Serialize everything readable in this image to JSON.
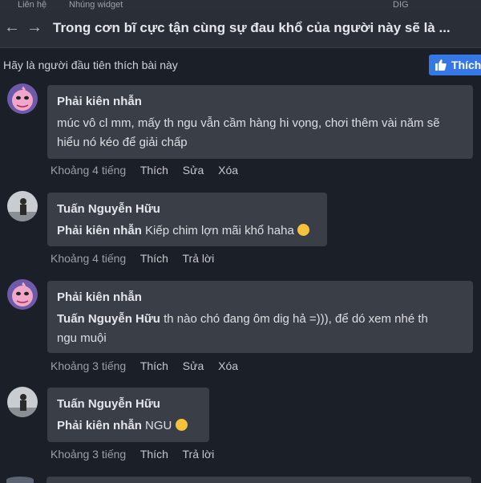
{
  "topstrip": {
    "left1": "Liên hệ",
    "left2": "Nhúng widget",
    "right": "DIG"
  },
  "header": {
    "back_icon": "arrow-left-icon",
    "forward_icon": "arrow-right-icon",
    "title": "Trong cơn bĩ cực tận cùng sự đau khổ của người này sẽ là ..."
  },
  "likebar": {
    "text": "Hãy là người đầu tiên thích bài này",
    "like_label": "Thích"
  },
  "comments": [
    {
      "author": "Phải kiên nhẫn",
      "avatar": "pink-character-avatar",
      "line1": "múc vô cl mm, mấy th ngu vẫn cầm hàng hi vọng, chơi thêm vài năm sẽ",
      "line2": "hiểu nó kéo để giải chấp",
      "time": "Khoảng 4 tiếng",
      "actions": [
        "Thích",
        "Sửa",
        "Xóa"
      ]
    },
    {
      "author": "Tuấn Nguyễn Hữu",
      "avatar": "person-photo-avatar",
      "mention": "Phải kiên nhẫn",
      "text": " Kiếp chim lợn mãi khổ haha",
      "time": "Khoảng 4 tiếng",
      "actions": [
        "Thích",
        "Trả lời"
      ]
    },
    {
      "author": "Phải kiên nhẫn",
      "avatar": "pink-character-avatar",
      "mention": "Tuấn Nguyễn Hữu",
      "text": " th nào chó đang ôm dig hả =))), để dó xem nhé th",
      "line2": "ngu muội",
      "time": "Khoảng 3 tiếng",
      "actions": [
        "Thích",
        "Sửa",
        "Xóa"
      ]
    },
    {
      "author": "Tuấn Nguyễn Hữu",
      "avatar": "person-photo-avatar",
      "mention": "Phải kiên nhẫn",
      "text": " NGU",
      "time": "Khoảng 3 tiếng",
      "actions": [
        "Thích",
        "Trả lời"
      ]
    }
  ],
  "colors": {
    "background": "#1b1f27",
    "bubble": "#3a3f47",
    "like_button": "#3578e5"
  }
}
